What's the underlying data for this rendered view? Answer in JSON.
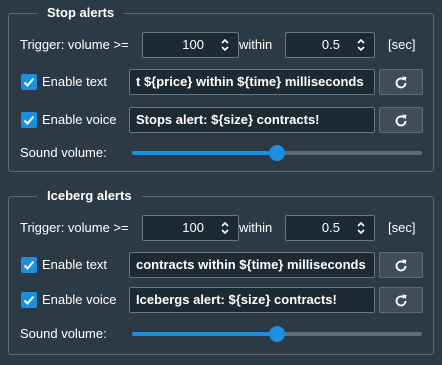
{
  "stop": {
    "title": "Stop alerts",
    "trigger_label": "Trigger: volume >=",
    "volume_value": "100",
    "within_label": "within",
    "time_value": "0.5",
    "unit_label": "[sec]",
    "text_label": "Enable text",
    "text_checked": true,
    "text_value": "t ${price} within ${time} milliseconds",
    "voice_label": "Enable voice",
    "voice_checked": true,
    "voice_value": "Stops alert: ${size} contracts!",
    "sound_label": "Sound volume:",
    "sound_level": 0.5
  },
  "iceberg": {
    "title": "Iceberg alerts",
    "trigger_label": "Trigger: volume >=",
    "volume_value": "100",
    "within_label": "within",
    "time_value": "0.5",
    "unit_label": "[sec]",
    "text_label": "Enable text",
    "text_checked": true,
    "text_value": "contracts within ${time} milliseconds",
    "voice_label": "Enable voice",
    "voice_checked": true,
    "voice_value": "Icebergs alert: ${size} contracts!",
    "sound_label": "Sound volume:",
    "sound_level": 0.5
  },
  "colors": {
    "background": "#2b3a44",
    "accent": "#1d8fe0",
    "field_bg": "#1c2a33"
  },
  "icons": {
    "spin": "up-down-arrows-icon",
    "checkbox": "checkmark-icon",
    "reset": "reload-icon"
  }
}
